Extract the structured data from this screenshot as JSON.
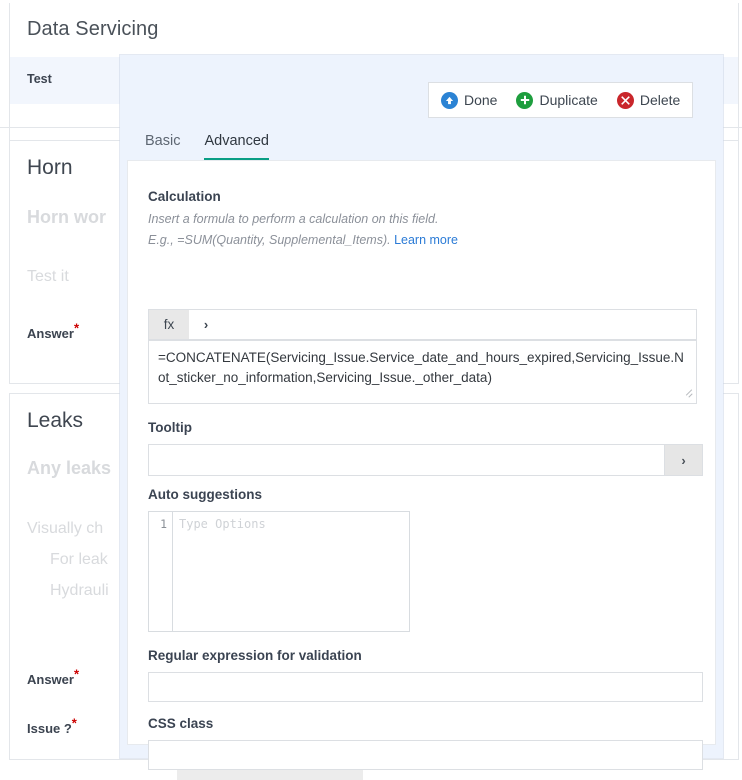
{
  "page": {
    "title": "Data Servicing",
    "test_row": {
      "label": "Test",
      "value": ""
    },
    "sections": [
      {
        "title": "Horn",
        "questions": [
          "Horn wor",
          "Test it"
        ],
        "labels": [
          "Answer"
        ]
      },
      {
        "title": "Leaks",
        "questions": [
          "Any leaks",
          "Visually ch",
          "For leak",
          "Hydrauli"
        ],
        "labels": [
          "Answer",
          "Issue ?"
        ]
      }
    ],
    "required_marker": "*"
  },
  "modal": {
    "toolbar": [
      {
        "label": "Done",
        "icon": "arrow-up-circle-icon",
        "color": "#2b83d4"
      },
      {
        "label": "Duplicate",
        "icon": "plus-circle-icon",
        "color": "#1e9e3e"
      },
      {
        "label": "Delete",
        "icon": "x-circle-icon",
        "color": "#c9262b"
      }
    ],
    "tabs": [
      {
        "label": "Basic",
        "active": false
      },
      {
        "label": "Advanced",
        "active": true
      }
    ],
    "accent_color": "#0a9e85",
    "calculation": {
      "label": "Calculation",
      "help_line1": "Insert a formula to perform a calculation on this field.",
      "help_line2_prefix": "E.g., =SUM(Quantity, Supplemental_Items).",
      "help_link": "Learn more",
      "fx_button": "fx",
      "chevron": "›",
      "formula": "=CONCATENATE(Servicing_Issue.Service_date_and_hours_expired,Servicing_Issue.Not_sticker_no_information,Servicing_Issue._other_data)"
    },
    "tooltip": {
      "label": "Tooltip",
      "value": "",
      "placeholder": "",
      "go_button": "›"
    },
    "auto_suggestions": {
      "label": "Auto suggestions",
      "line_number": "1",
      "placeholder": "Type Options",
      "value": ""
    },
    "regex": {
      "label": "Regular expression for validation",
      "value": "",
      "placeholder": ""
    },
    "css_class": {
      "label": "CSS class",
      "value": "",
      "placeholder": ""
    }
  }
}
